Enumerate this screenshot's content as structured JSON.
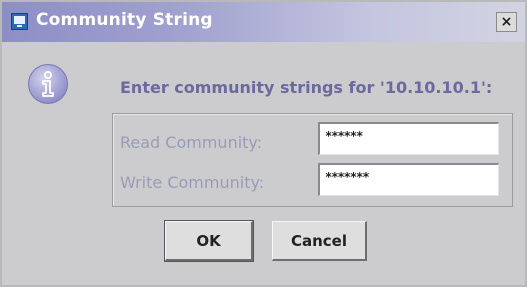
{
  "window": {
    "title": "Community String",
    "close_glyph": "×"
  },
  "dialog": {
    "prompt": "Enter community strings for '10.10.10.1':",
    "icon": "info-icon",
    "read_label": "Read Community:",
    "read_value": "******",
    "write_label": "Write Community:",
    "write_value": "*******"
  },
  "buttons": {
    "ok_label": "OK",
    "cancel_label": "Cancel"
  },
  "colors": {
    "title_gradient_start": "#8c8ec6",
    "dialog_background": "#ccccce",
    "prompt_text": "#6a6a9e",
    "label_text": "#9b9bb7"
  }
}
